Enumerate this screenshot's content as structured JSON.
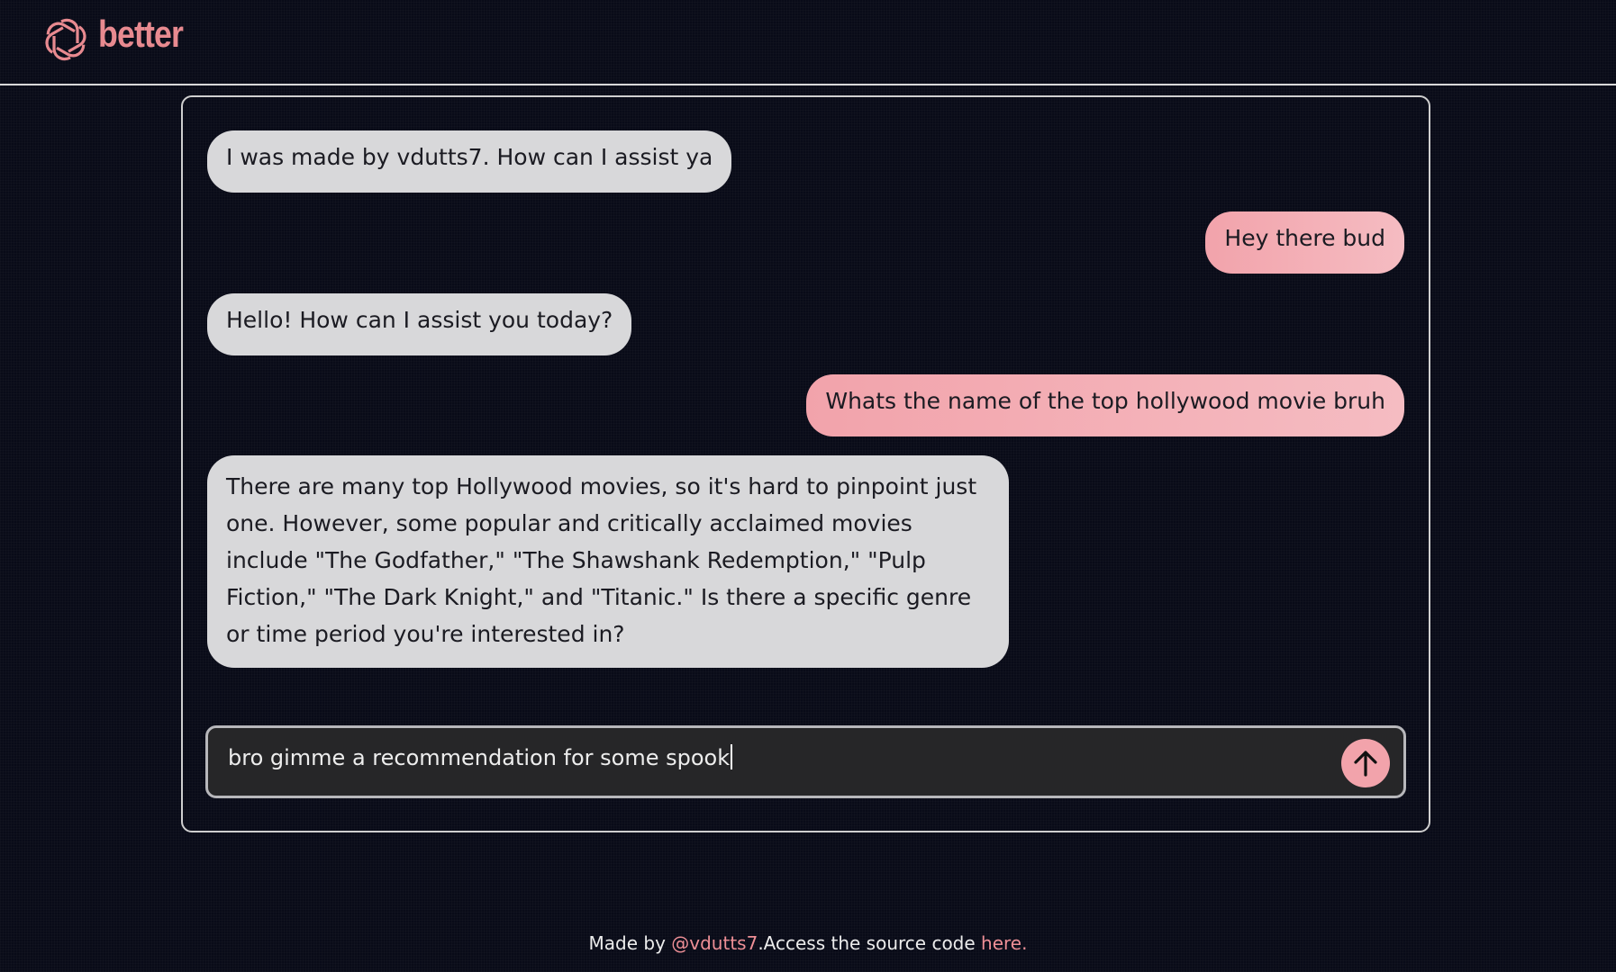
{
  "header": {
    "logo_icon": "openai-knot-icon",
    "brand": "better",
    "brand_color": "#e88a90"
  },
  "messages": [
    {
      "role": "bot",
      "text": "I was made by vdutts7. How can I assist ya"
    },
    {
      "role": "user",
      "text": "Hey there bud"
    },
    {
      "role": "bot",
      "text": "Hello! How can I assist you today?"
    },
    {
      "role": "user",
      "text": "Whats the name of the top hollywood movie bruh"
    },
    {
      "role": "bot",
      "text": "There are many top Hollywood movies, so it's hard to pinpoint just one. However, some popular and critically acclaimed movies include \"The Godfather,\" \"The Shawshank Redemption,\" \"Pulp Fiction,\" \"The Dark Knight,\" and \"Titanic.\" Is there a specific genre or time period you're interested in?"
    }
  ],
  "composer": {
    "value": "bro gimme a recommendation for some spook",
    "send_icon": "arrow-up-icon"
  },
  "footer": {
    "prefix": "Made by ",
    "author_link": "@vdutts7",
    "middle": ".Access the source code ",
    "source_link": "here",
    "suffix": "."
  },
  "colors": {
    "background": "#090b18",
    "bot_bubble": "#d8d8da",
    "user_bubble": "#f2a3ab",
    "accent": "#ee8f96"
  }
}
